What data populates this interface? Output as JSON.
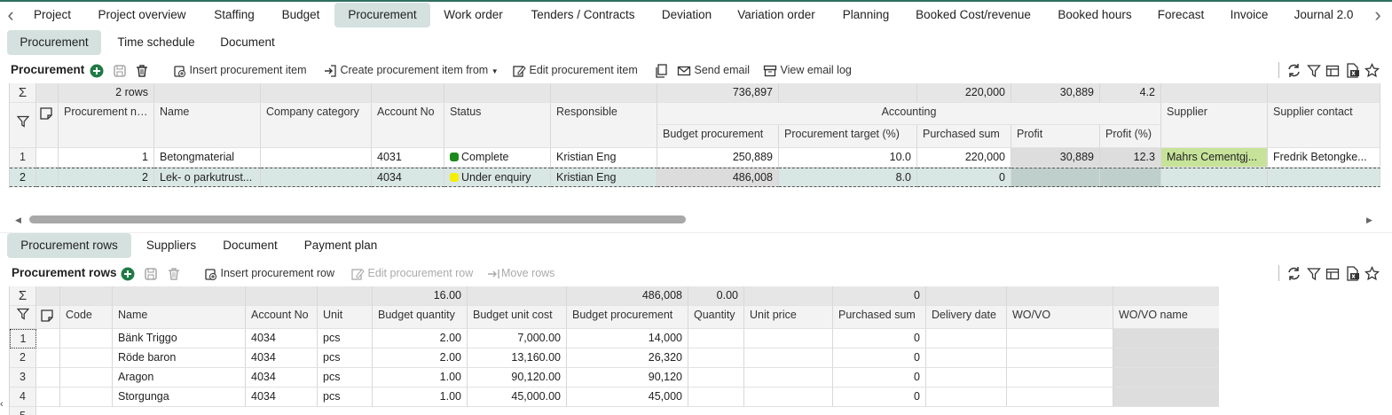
{
  "top_tabs": [
    "Project",
    "Project overview",
    "Staffing",
    "Budget",
    "Procurement",
    "Work order",
    "Tenders / Contracts",
    "Deviation",
    "Variation order",
    "Planning",
    "Booked Cost/revenue",
    "Booked hours",
    "Forecast",
    "Invoice",
    "Journal 2.0"
  ],
  "sub_tabs": [
    "Procurement",
    "Time schedule",
    "Document"
  ],
  "procurement_toolbar": {
    "title": "Procurement",
    "insert": "Insert procurement item",
    "create_from": "Create procurement item from",
    "edit": "Edit procurement item",
    "send_email": "Send email",
    "view_log": "View email log"
  },
  "procurement_grid": {
    "sum_row": {
      "rows": "2 rows",
      "budget": "736,897",
      "purchased": "220,000",
      "profit": "30,889",
      "profit_pct": "4.2"
    },
    "headers": {
      "no": "Procurement no",
      "name": "Name",
      "category": "Company category",
      "account": "Account No",
      "status": "Status",
      "responsible": "Responsible",
      "accounting": "Accounting",
      "budget": "Budget procurement",
      "target": "Procurement target (%)",
      "purchased": "Purchased sum",
      "profit": "Profit",
      "profit_pct": "Profit (%)",
      "supplier": "Supplier",
      "supplier_contact": "Supplier contact"
    },
    "rows": [
      {
        "idx": "1",
        "no": "1",
        "name": "Betongmaterial",
        "category": "",
        "account": "4031",
        "status": "Complete",
        "status_color": "#1a8a1a",
        "responsible": "Kristian Eng",
        "budget": "250,889",
        "target": "10.0",
        "purchased": "220,000",
        "profit": "30,889",
        "profit_pct": "12.3",
        "supplier": "Mahrs Cementgj...",
        "supplier_contact": "Fredrik Betongke..."
      },
      {
        "idx": "2",
        "no": "2",
        "name": "Lek- o parkutrust...",
        "category": "",
        "account": "4034",
        "status": "Under enquiry",
        "status_color": "#f5f000",
        "responsible": "Kristian Eng",
        "budget": "486,008",
        "target": "8.0",
        "purchased": "0",
        "profit": "",
        "profit_pct": "",
        "supplier": "",
        "supplier_contact": ""
      }
    ]
  },
  "lower_tabs": [
    "Procurement rows",
    "Suppliers",
    "Document",
    "Payment plan"
  ],
  "rows_toolbar": {
    "title": "Procurement rows",
    "insert": "Insert procurement row",
    "edit": "Edit procurement row",
    "move": "Move rows"
  },
  "rows_grid": {
    "sum_row": {
      "budget_qty": "16.00",
      "budget_proc": "486,008",
      "quantity": "0.00",
      "purchased": "0"
    },
    "headers": {
      "code": "Code",
      "name": "Name",
      "account": "Account No",
      "unit": "Unit",
      "budget_qty": "Budget quantity",
      "unit_cost": "Budget unit cost",
      "budget_proc": "Budget procurement",
      "quantity": "Quantity",
      "unit_price": "Unit price",
      "purchased": "Purchased sum",
      "delivery": "Delivery date",
      "wovo": "WO/VO",
      "wovo_name": "WO/VO name"
    },
    "rows": [
      {
        "idx": "1",
        "name": "Bänk Triggo",
        "account": "4034",
        "unit": "pcs",
        "budget_qty": "2.00",
        "unit_cost": "7,000.00",
        "budget_proc": "14,000",
        "purchased": "0"
      },
      {
        "idx": "2",
        "name": "Röde baron",
        "account": "4034",
        "unit": "pcs",
        "budget_qty": "2.00",
        "unit_cost": "13,160.00",
        "budget_proc": "26,320",
        "purchased": "0"
      },
      {
        "idx": "3",
        "name": "Aragon",
        "account": "4034",
        "unit": "pcs",
        "budget_qty": "1.00",
        "unit_cost": "90,120.00",
        "budget_proc": "90,120",
        "purchased": "0"
      },
      {
        "idx": "4",
        "name": "Storgunga",
        "account": "4034",
        "unit": "pcs",
        "budget_qty": "1.00",
        "unit_cost": "45,000.00",
        "budget_proc": "45,000",
        "purchased": "0"
      }
    ]
  }
}
